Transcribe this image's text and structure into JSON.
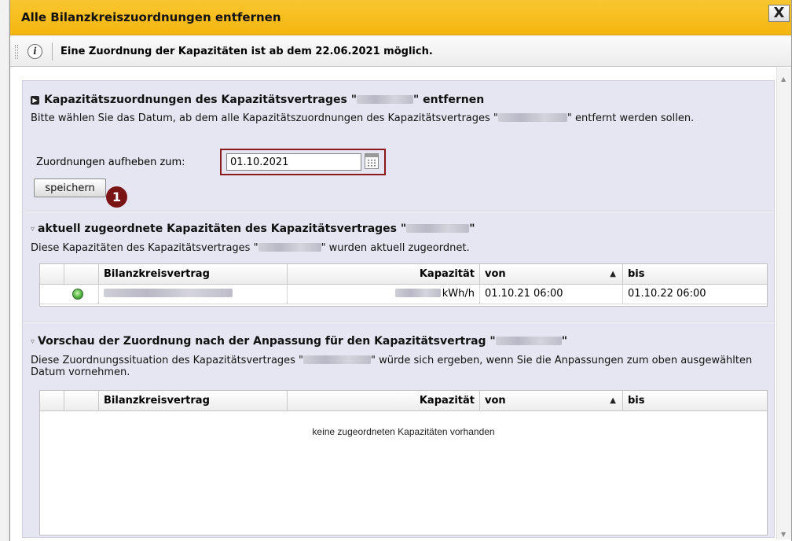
{
  "dialog": {
    "title": "Alle Bilanzkreiszuordnungen entfernen",
    "close_label": "X"
  },
  "info": {
    "icon": "info-icon",
    "text": "Eine Zuordnung der Kapazitäten ist ab dem 22.06.2021 möglich."
  },
  "section_remove": {
    "title_prefix": "Kapazitätszuordnungen des Kapazitätsvertrages \"",
    "title_suffix": "\" entfernen",
    "desc_prefix": "Bitte wählen Sie das Datum, ab dem alle Kapazitätszuordnungen des Kapazitätsvertrages \"",
    "desc_suffix": "\" entfernt werden sollen.",
    "field_label": "Zuordnungen aufheben zum:",
    "date_value": "01.10.2021",
    "save_label": "speichern",
    "step_badge": "1"
  },
  "section_current": {
    "title_prefix": "aktuell zugeordnete Kapazitäten des Kapazitätsvertrages \"",
    "title_suffix": "\"",
    "desc_prefix": "Diese Kapazitäten des Kapazitätsvertrages \"",
    "desc_suffix": "\" wurden aktuell zugeordnet.",
    "columns": [
      "Bilanzkreisvertrag",
      "Kapazität",
      "von",
      "bis"
    ],
    "rows": [
      {
        "status": "active",
        "capacity_unit": "kWh/h",
        "from": "01.10.21 06:00",
        "to": "01.10.22 06:00"
      }
    ]
  },
  "section_preview": {
    "title_prefix": "Vorschau der Zuordnung nach der Anpassung für den Kapazitätsvertrag \"",
    "title_suffix": "\"",
    "desc_prefix": "Diese Zuordnungssituation des Kapazitätsvertrages \"",
    "desc_suffix": "\" würde sich ergeben, wenn Sie die Anpassungen zum oben ausgewählten Datum vornehmen.",
    "columns": [
      "Bilanzkreisvertrag",
      "Kapazität",
      "von",
      "bis"
    ],
    "empty_message": "keine zugeordneten Kapazitäten vorhanden"
  },
  "colors": {
    "titlebar": "#f5b60f",
    "highlight_border": "#8b1a1a",
    "content_bg": "#e6e6f2"
  }
}
